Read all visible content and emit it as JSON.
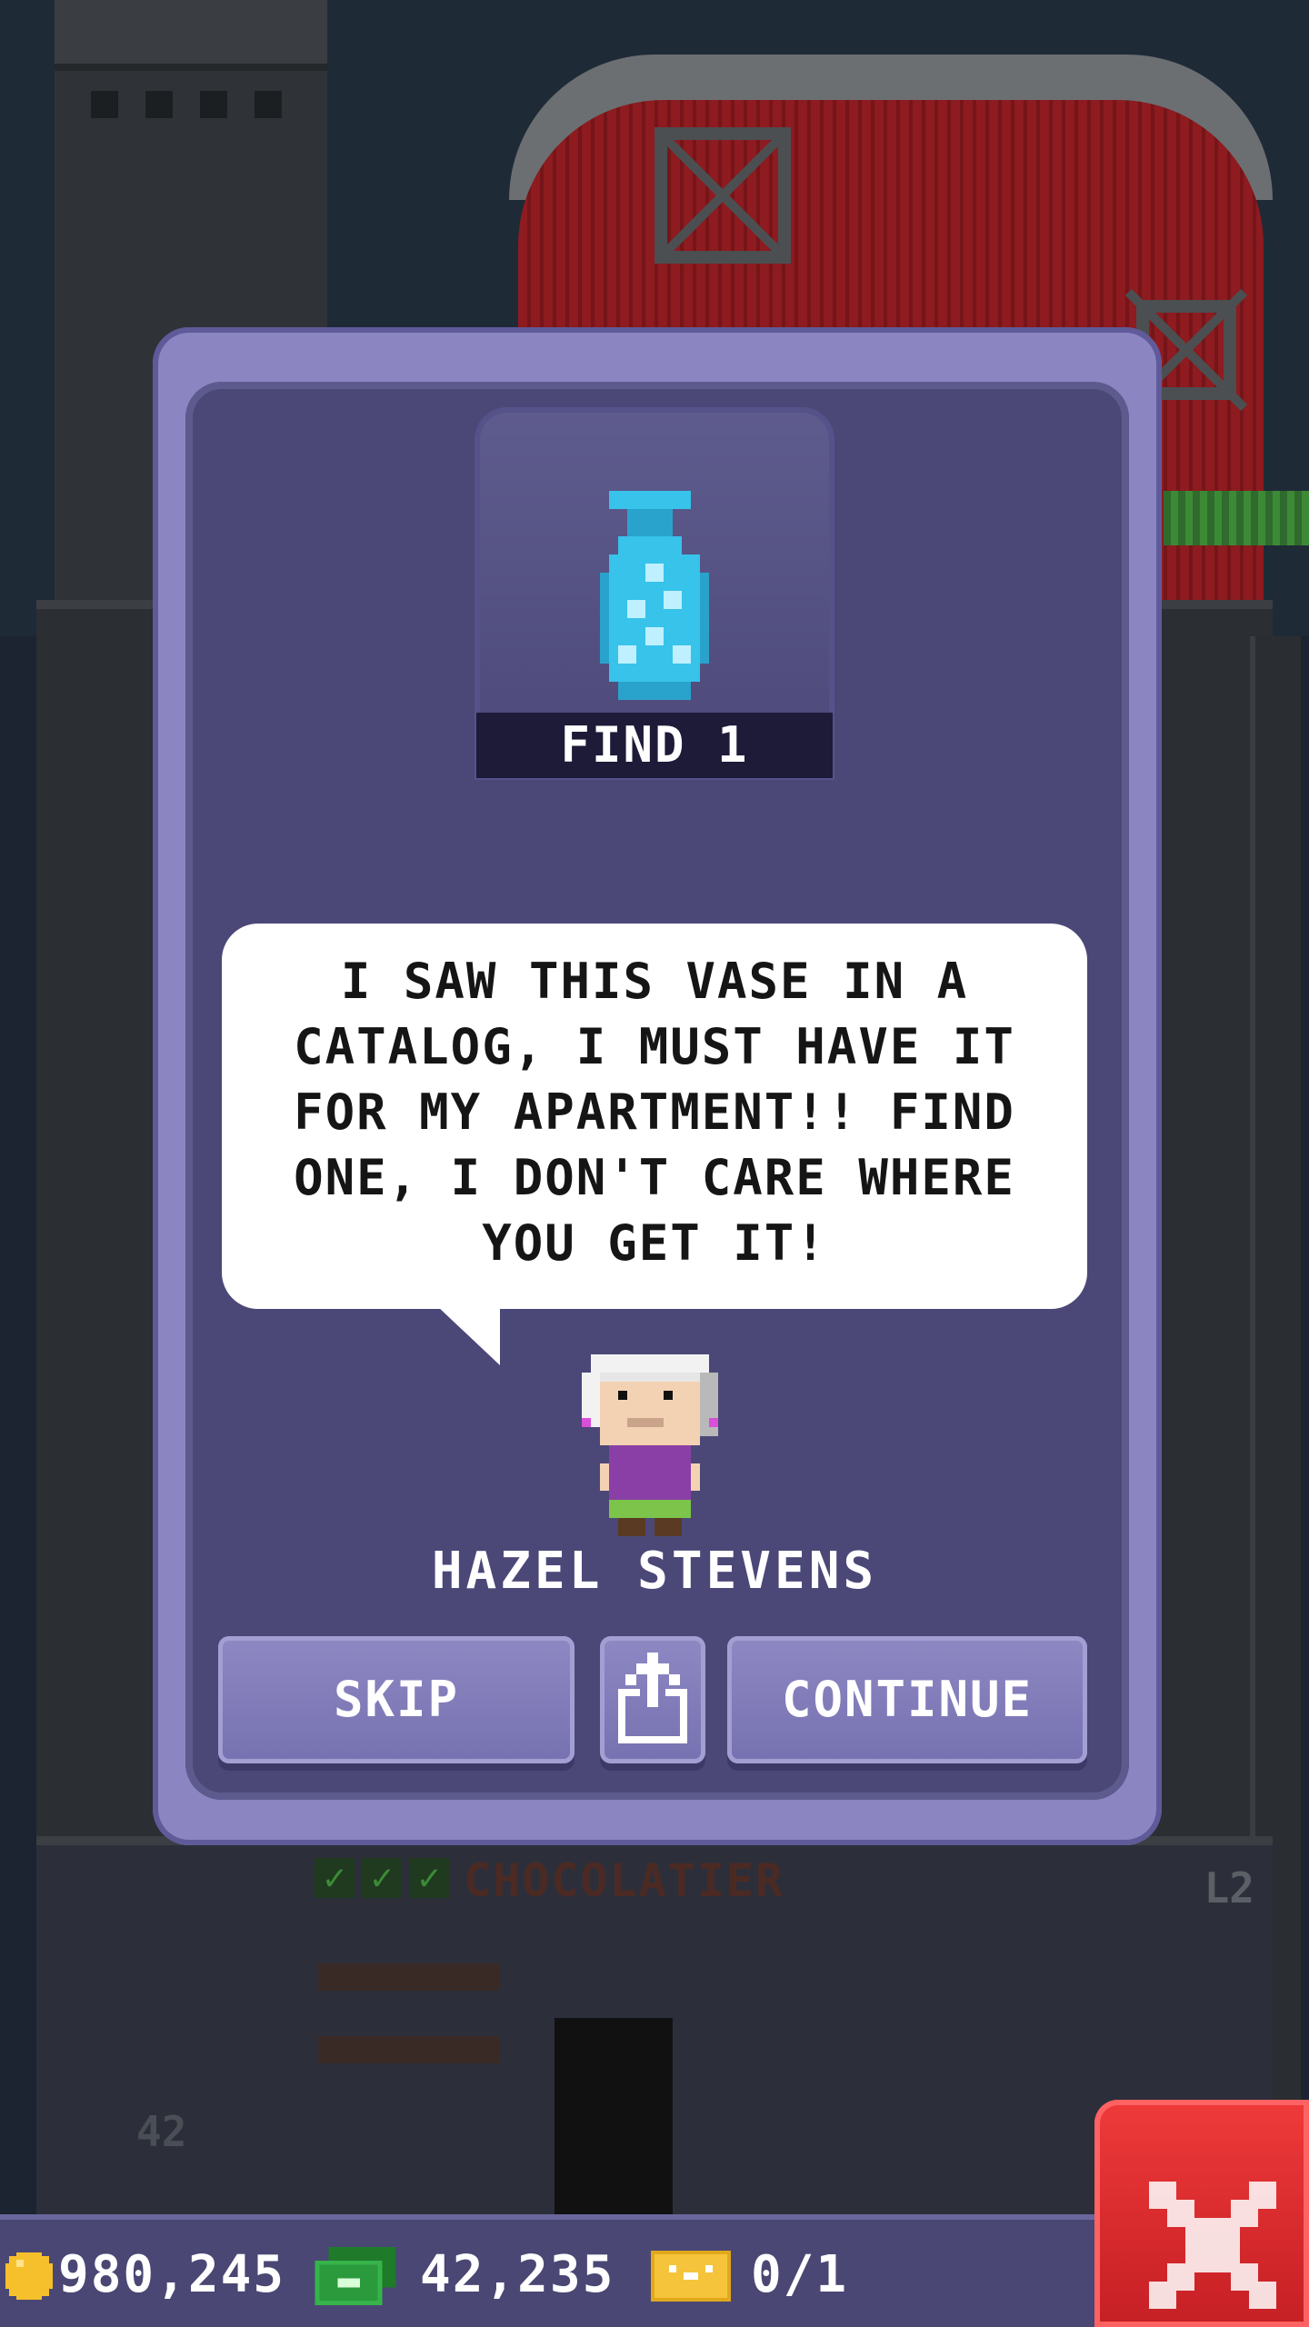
{
  "dialog": {
    "find_label": "FIND 1",
    "message": "I SAW THIS VASE IN A CATALOG, I MUST HAVE IT FOR MY APARTMENT!! FIND ONE, I DON'T CARE WHERE YOU GET IT!",
    "character_name": "HAZEL STEVENS",
    "item_icon": "vase-icon",
    "buttons": {
      "skip": "SKIP",
      "share_icon": "share-icon",
      "continue": "CONTINUE"
    }
  },
  "status_bar": {
    "coins": "980,245",
    "bux": "42,235",
    "tickets": "0/1"
  },
  "background": {
    "floor_name": "CHOCOLATIER",
    "floor_level": "L2",
    "floor_number": "42"
  },
  "colors": {
    "dialog_outer": "#8b85c2",
    "dialog_inner": "#4b4878",
    "button": "#8e89c3",
    "close_button": "#e03034",
    "vase": "#37c3ea"
  }
}
